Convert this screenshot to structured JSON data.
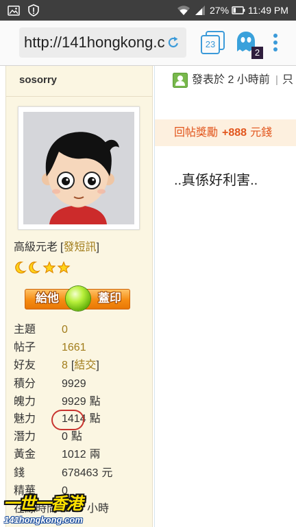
{
  "status_bar": {
    "battery_text": "27%",
    "time": "11:49 PM",
    "left_icons": [
      "gallery-icon",
      "alert-shield-icon"
    ],
    "right_icons": [
      "wifi-icon",
      "signal-icon",
      "battery-icon"
    ],
    "battery_level": 0.27
  },
  "browser": {
    "url": "http://141hongkong.c",
    "tab_count": "23",
    "extension_badge_count": "2",
    "icons": [
      "reload-icon",
      "tabs-icon",
      "ghost-extension-icon",
      "overflow-menu-icon"
    ]
  },
  "post": {
    "author": "sosorry",
    "header": {
      "posted": "發表於 2 小時前",
      "separator": "|",
      "view_only": "只"
    },
    "profile": {
      "group": "高級元老",
      "bracket_open": "[",
      "pm_link": "發短訊",
      "bracket_close": "]",
      "rank_icons": [
        "moon-icon",
        "moon-icon",
        "star-icon",
        "star-icon"
      ],
      "stamp_button": {
        "left": "給他",
        "right": "蓋印"
      }
    },
    "stats": [
      {
        "label": "主題",
        "value": "0"
      },
      {
        "label": "帖子",
        "value": "1661"
      },
      {
        "label": "好友",
        "value": "8",
        "bracket_open": "[",
        "link": "結交",
        "bracket_close": "]"
      },
      {
        "label": "積分",
        "value": "9929"
      },
      {
        "label": "魄力",
        "value": "9929",
        "unit": "點"
      },
      {
        "label": "魅力",
        "value": "1414",
        "unit": "點"
      },
      {
        "label": "潛力",
        "value": "0",
        "unit": "點"
      },
      {
        "label": "黃金",
        "value": "1012",
        "unit": "兩"
      },
      {
        "label": "錢",
        "value": "678463",
        "unit": "元"
      },
      {
        "label": "精華",
        "value": "0"
      },
      {
        "label": "在線時間",
        "unit": "小時"
      }
    ],
    "reward": {
      "label": "回帖獎勵",
      "amount": "+888",
      "unit": "元錢"
    },
    "message": "..真係好利害.."
  },
  "watermark": {
    "title": "一世一香港",
    "domain": "141hongkong.com"
  },
  "colors": {
    "status_bar": "#3e3e3e",
    "accent": "#3b9ad9",
    "link": "#a17c1a",
    "reward_text": "#e2561d",
    "reward_bg": "#fdf0df",
    "highlight": "#c8342f",
    "profile_bg": "#fbf6e2",
    "badge_bg": "#2f1d3d"
  }
}
